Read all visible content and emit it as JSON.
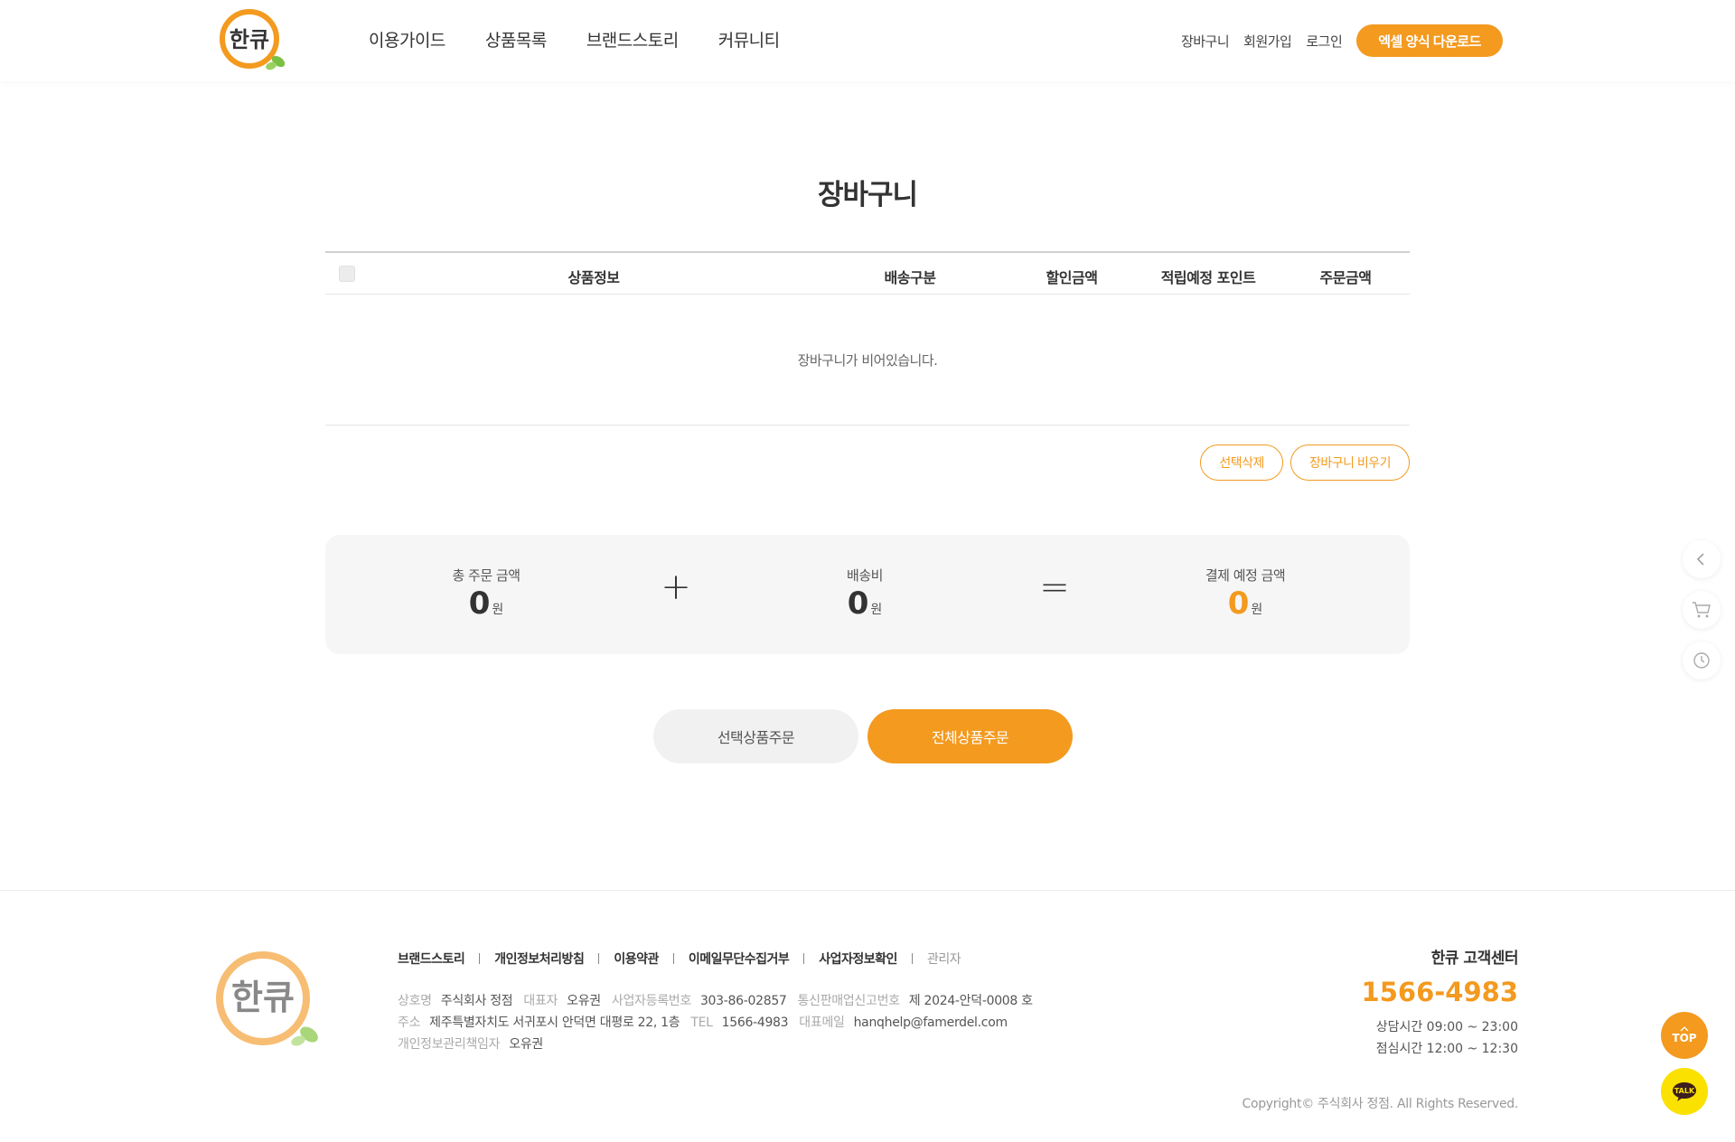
{
  "brand": {
    "logo_text": "한큐",
    "accent": "#f39a1f"
  },
  "gnb": [
    "이용가이드",
    "상품목록",
    "브랜드스토리",
    "커뮤니티"
  ],
  "util": {
    "cart": "장바구니",
    "join": "회원가입",
    "login": "로그인",
    "excel_download": "엑셀 양식 다운로드"
  },
  "page": {
    "title": "장바구니"
  },
  "cart": {
    "columns": [
      "상품정보",
      "배송구분",
      "할인금액",
      "적립예정 포인트",
      "주문금액"
    ],
    "empty_message": "장바구니가 비어있습니다.",
    "delete_selected": "선택삭제",
    "empty_cart": "장바구니 비우기"
  },
  "summary": {
    "total_label": "총 주문 금액",
    "total_value": "0",
    "shipping_label": "배송비",
    "shipping_value": "0",
    "payment_label": "결제 예정 금액",
    "payment_value": "0",
    "unit": "원",
    "plus": "+",
    "equals": "="
  },
  "order": {
    "selected": "선택상품주문",
    "all": "전체상품주문"
  },
  "quick": [
    "chevron-left-icon",
    "cart-icon",
    "history-icon"
  ],
  "footer": {
    "links": [
      "브랜드스토리",
      "개인정보처리방침",
      "이용약관",
      "이메일무단수집거부",
      "사업자정보확인",
      "관리자"
    ],
    "info": {
      "company_label": "상호명",
      "company": "주식회사 정점",
      "ceo_label": "대표자",
      "ceo": "오유권",
      "bizno_label": "사업자등록번호",
      "bizno": "303-86-02857",
      "mailorder_label": "통신판매업신고번호",
      "mailorder": "제 2024-안덕-0008 호",
      "address_label": "주소",
      "address": "제주특별자치도 서귀포시 안덕면 대평로 22, 1층",
      "tel_label": "TEL",
      "tel": "1566-4983",
      "email_label": "대표메일",
      "email": "hanqhelp@famerdel.com",
      "privacy_label": "개인정보관리책임자",
      "privacy": "오유권"
    },
    "cs": {
      "title": "한큐 고객센터",
      "phone": "1566-4983",
      "hours": "상담시간 09:00 ~ 23:00",
      "lunch": "점심시간 12:00 ~ 12:30"
    },
    "copyright": "Copyright© 주식회사 정점. All Rights Reserved."
  },
  "floating": {
    "top": "TOP",
    "talk": "TALK"
  }
}
